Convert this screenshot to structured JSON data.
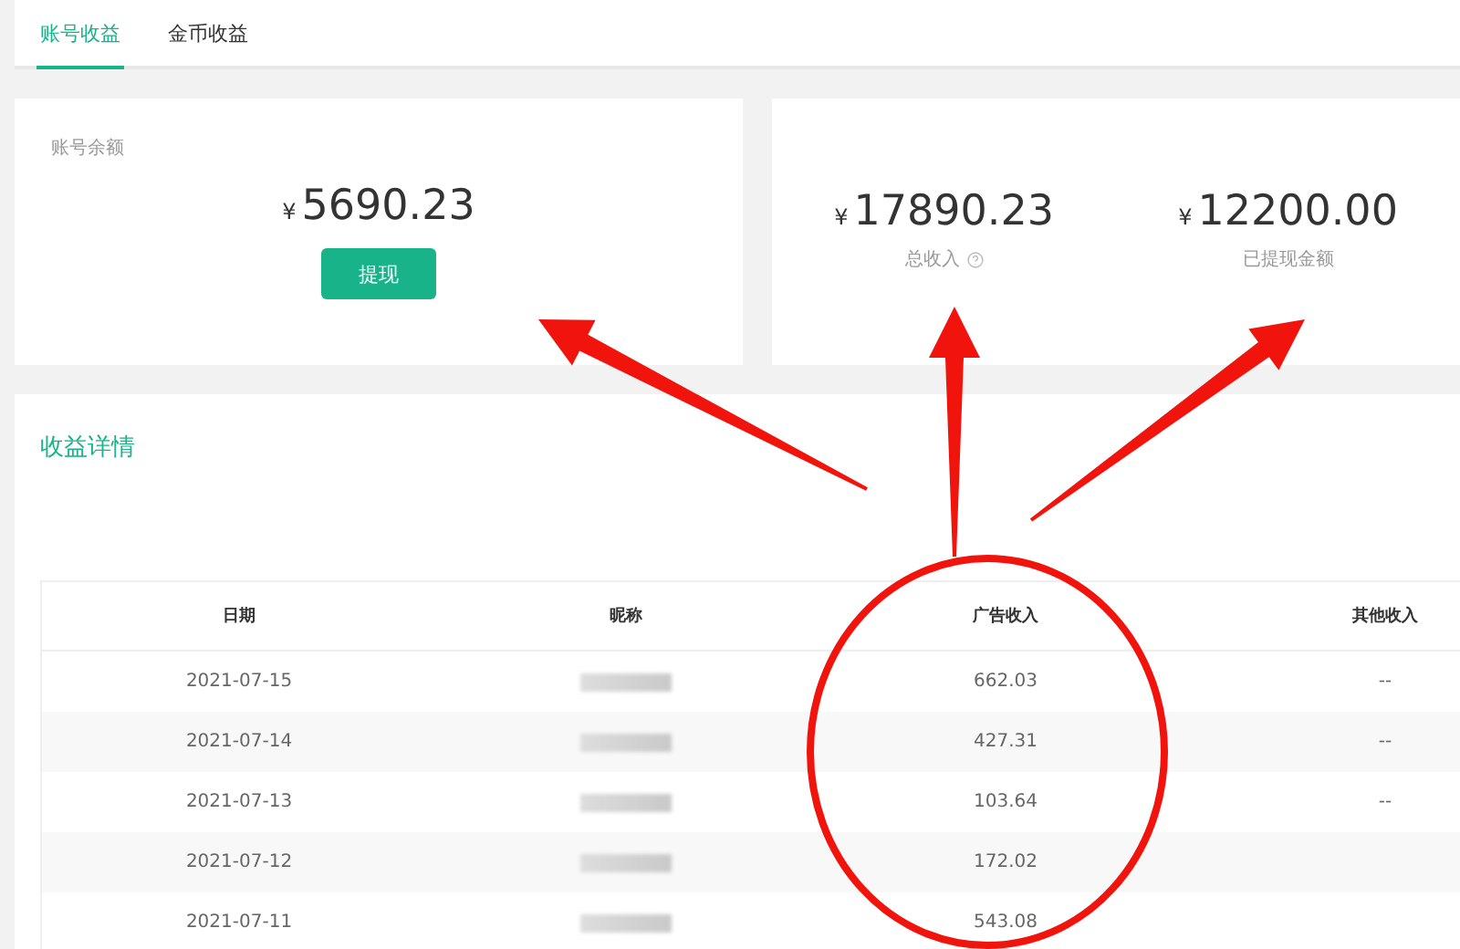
{
  "tabs": [
    {
      "label": "账号收益",
      "selected": true
    },
    {
      "label": "金币收益",
      "selected": false
    }
  ],
  "balance": {
    "label": "账号余额",
    "currency": "¥",
    "amount": "5690.23",
    "button": "提现"
  },
  "totals": [
    {
      "currency": "¥",
      "amount": "17890.23",
      "label": "总收入",
      "help": true
    },
    {
      "currency": "¥",
      "amount": "12200.00",
      "label": "已提现金额",
      "help": false
    }
  ],
  "details": {
    "title": "收益详情",
    "columns": [
      "日期",
      "昵称",
      "广告收入",
      "其他收入"
    ],
    "rows": [
      {
        "date": "2021-07-15",
        "nickname_hidden": true,
        "ad_income": "662.03",
        "other_income": "--"
      },
      {
        "date": "2021-07-14",
        "nickname_hidden": true,
        "ad_income": "427.31",
        "other_income": "--"
      },
      {
        "date": "2021-07-13",
        "nickname_hidden": true,
        "ad_income": "103.64",
        "other_income": "--"
      },
      {
        "date": "2021-07-12",
        "nickname_hidden": true,
        "ad_income": "172.02"
      },
      {
        "date": "2021-07-11",
        "nickname_hidden": true,
        "ad_income": "543.08"
      }
    ]
  },
  "annotations": {
    "arrows": true,
    "circle": true
  }
}
